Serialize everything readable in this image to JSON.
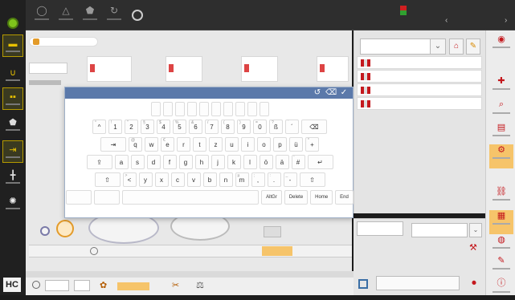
{
  "colors": {
    "accent_orange": "#f6c46a",
    "brand_red": "#c4181d",
    "keyboard_header": "#5b79aa",
    "power_green": "#7fc31c"
  },
  "left_sidebar": {
    "logo_text": "HC",
    "items": [
      {
        "icon": "machine-icon",
        "label": ""
      },
      {
        "icon": "magnet-icon",
        "label": ""
      },
      {
        "icon": "lights-icon",
        "label": ""
      },
      {
        "icon": "bobbin-icon",
        "label": ""
      },
      {
        "icon": "sequence-icon",
        "label": ""
      },
      {
        "icon": "adjust-icon",
        "label": ""
      },
      {
        "icon": "light-bulb-icon",
        "label": ""
      }
    ]
  },
  "top_bar": {
    "buttons": [
      {
        "icon": "stop-icon",
        "label": ""
      },
      {
        "icon": "warning-icon",
        "label": ""
      },
      {
        "icon": "bobbin-icon",
        "label": ""
      },
      {
        "icon": "refresh-icon",
        "label": ""
      }
    ],
    "title_line_1": "",
    "title_line_2": "",
    "date": "",
    "user": ""
  },
  "workspace": {
    "tab_label": "",
    "cards": [
      "",
      "",
      "",
      ""
    ],
    "left_field_label": ""
  },
  "keyboard": {
    "header_icons": [
      "undo-icon",
      "clear-icon",
      "confirm-icon"
    ],
    "word_row": [
      "",
      "",
      "",
      "",
      "",
      "",
      "",
      "",
      "",
      ""
    ],
    "number_row": [
      {
        "main": "^",
        "alt": "°"
      },
      {
        "main": "1",
        "alt": "!"
      },
      {
        "main": "2",
        "alt": "\""
      },
      {
        "main": "3",
        "alt": "§"
      },
      {
        "main": "4",
        "alt": "$"
      },
      {
        "main": "5",
        "alt": "%"
      },
      {
        "main": "6",
        "alt": "&"
      },
      {
        "main": "7",
        "alt": "/"
      },
      {
        "main": "8",
        "alt": "("
      },
      {
        "main": "9",
        "alt": ")"
      },
      {
        "main": "0",
        "alt": "="
      },
      {
        "main": "ß",
        "alt": "?"
      },
      {
        "main": "´",
        "alt": "`"
      },
      {
        "main": "⌫",
        "alt": ""
      }
    ],
    "qwertz_row": [
      {
        "main": "⇥",
        "alt": ""
      },
      {
        "main": "q",
        "alt": "@"
      },
      {
        "main": "w",
        "alt": ""
      },
      {
        "main": "e",
        "alt": "€"
      },
      {
        "main": "r",
        "alt": ""
      },
      {
        "main": "t",
        "alt": ""
      },
      {
        "main": "z",
        "alt": ""
      },
      {
        "main": "u",
        "alt": ""
      },
      {
        "main": "i",
        "alt": ""
      },
      {
        "main": "o",
        "alt": ""
      },
      {
        "main": "p",
        "alt": ""
      },
      {
        "main": "ü",
        "alt": ""
      },
      {
        "main": "+",
        "alt": "*"
      }
    ],
    "asdf_row": [
      {
        "main": "⇪",
        "alt": ""
      },
      {
        "main": "a",
        "alt": ""
      },
      {
        "main": "s",
        "alt": ""
      },
      {
        "main": "d",
        "alt": ""
      },
      {
        "main": "f",
        "alt": ""
      },
      {
        "main": "g",
        "alt": ""
      },
      {
        "main": "h",
        "alt": ""
      },
      {
        "main": "j",
        "alt": ""
      },
      {
        "main": "k",
        "alt": ""
      },
      {
        "main": "l",
        "alt": ""
      },
      {
        "main": "ö",
        "alt": ""
      },
      {
        "main": "ä",
        "alt": ""
      },
      {
        "main": "#",
        "alt": "'"
      },
      {
        "main": "↵",
        "alt": ""
      }
    ],
    "yxcv_row": [
      {
        "main": "⇧",
        "alt": ""
      },
      {
        "main": "<",
        "alt": ">"
      },
      {
        "main": "y",
        "alt": ""
      },
      {
        "main": "x",
        "alt": ""
      },
      {
        "main": "c",
        "alt": ""
      },
      {
        "main": "v",
        "alt": ""
      },
      {
        "main": "b",
        "alt": ""
      },
      {
        "main": "n",
        "alt": ""
      },
      {
        "main": "m",
        "alt": "µ"
      },
      {
        "main": ",",
        "alt": ";"
      },
      {
        "main": ".",
        "alt": ":"
      },
      {
        "main": "-",
        "alt": "_"
      },
      {
        "main": "⇧",
        "alt": ""
      }
    ],
    "bottom_row": {
      "left_1": "",
      "left_2": "",
      "nav_keys": [
        "AltGr",
        "Delete",
        "Home",
        "End"
      ]
    }
  },
  "pattern_panel": {
    "select_label": "",
    "select_value": "",
    "items": [
      "",
      "",
      "",
      ""
    ]
  },
  "lower_right": {
    "field_label": "",
    "select_label": "",
    "select_value": "",
    "save_label": ""
  },
  "bottom_bar": {
    "header": "",
    "field_1": "",
    "value_1": "",
    "value_2": ""
  },
  "control_row": {
    "value": ""
  }
}
